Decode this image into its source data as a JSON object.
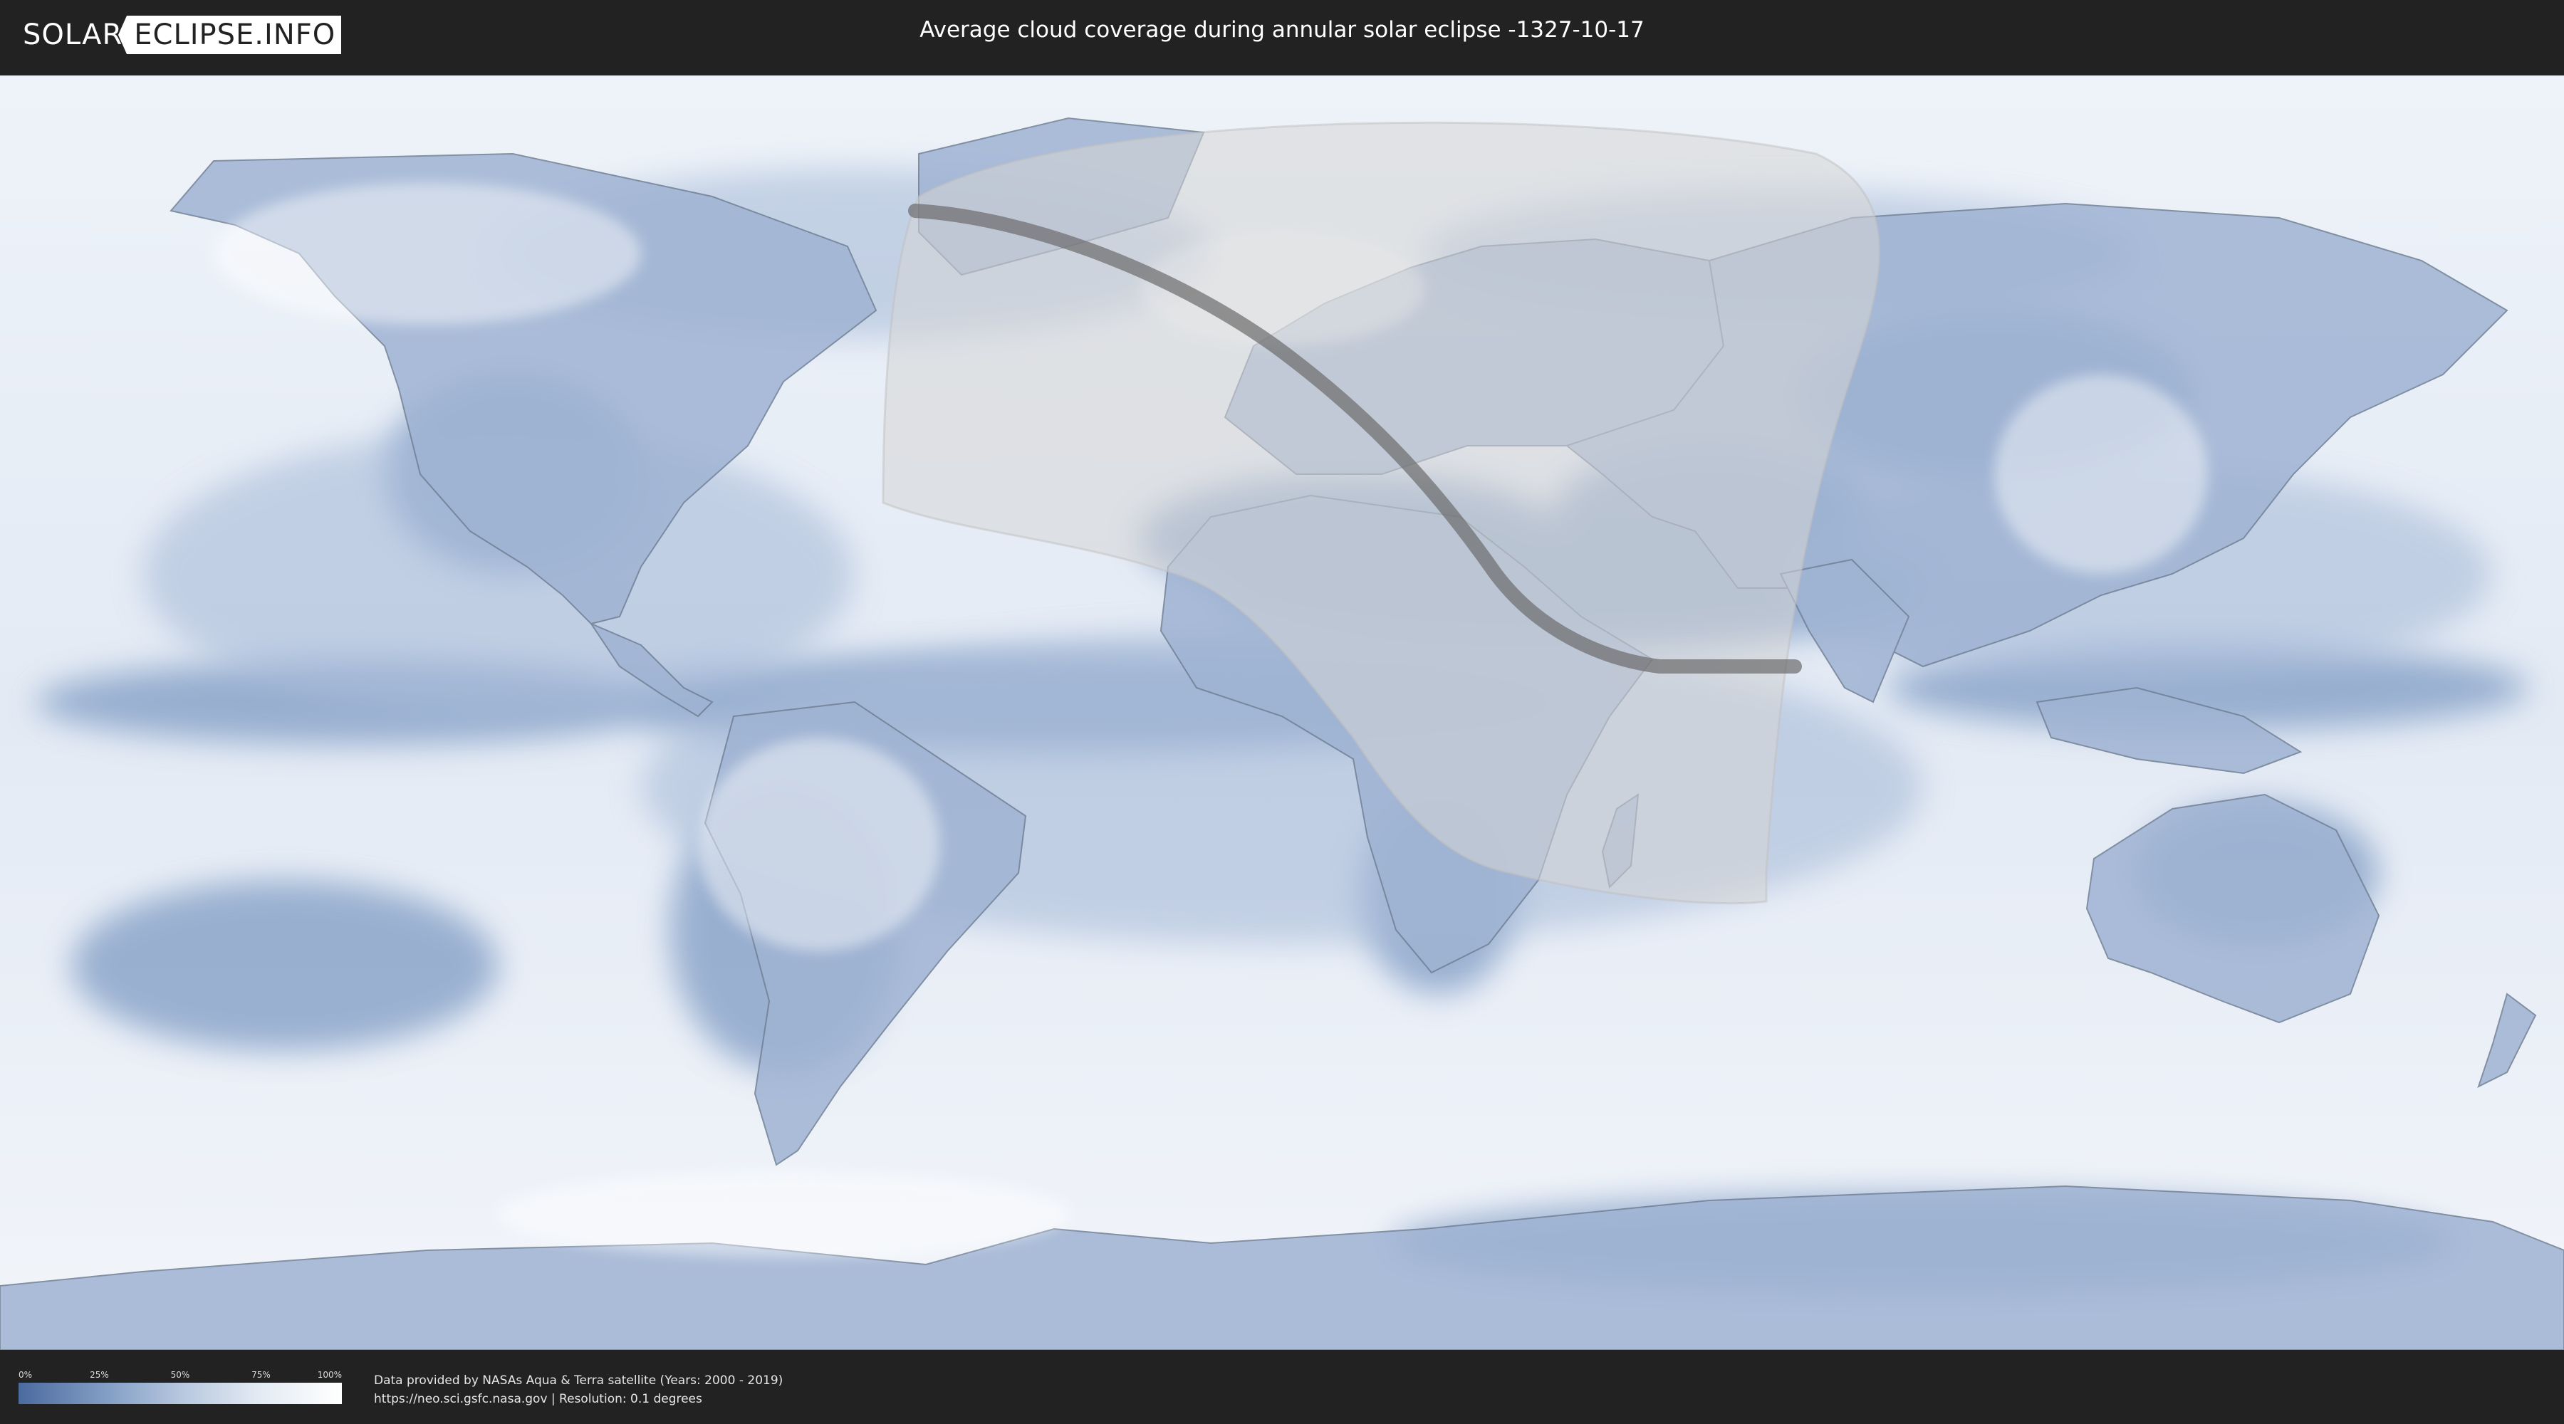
{
  "header": {
    "logo_left": "SOLAR",
    "logo_right": "ECLIPSE.INFO",
    "title": "Average cloud coverage during annular solar eclipse -1327-10-17"
  },
  "map": {
    "type": "world cloud coverage map",
    "eclipse_date": "-1327-10-17",
    "eclipse_type": "annular",
    "colors": {
      "ocean_clear": "#4b6a9e",
      "cloud_full": "#ffffff",
      "eclipse_zone": "#d9d9d9",
      "central_path": "#666666"
    }
  },
  "legend": {
    "ticks": [
      "0%",
      "25%",
      "50%",
      "75%",
      "100%"
    ],
    "gradient_from": "#4b6a9e",
    "gradient_to": "#ffffff"
  },
  "credits": {
    "line1": "Data provided by NASAs Aqua & Terra satellite (Years: 2000 - 2019)",
    "line2": "https://neo.sci.gsfc.nasa.gov | Resolution: 0.1 degrees"
  }
}
